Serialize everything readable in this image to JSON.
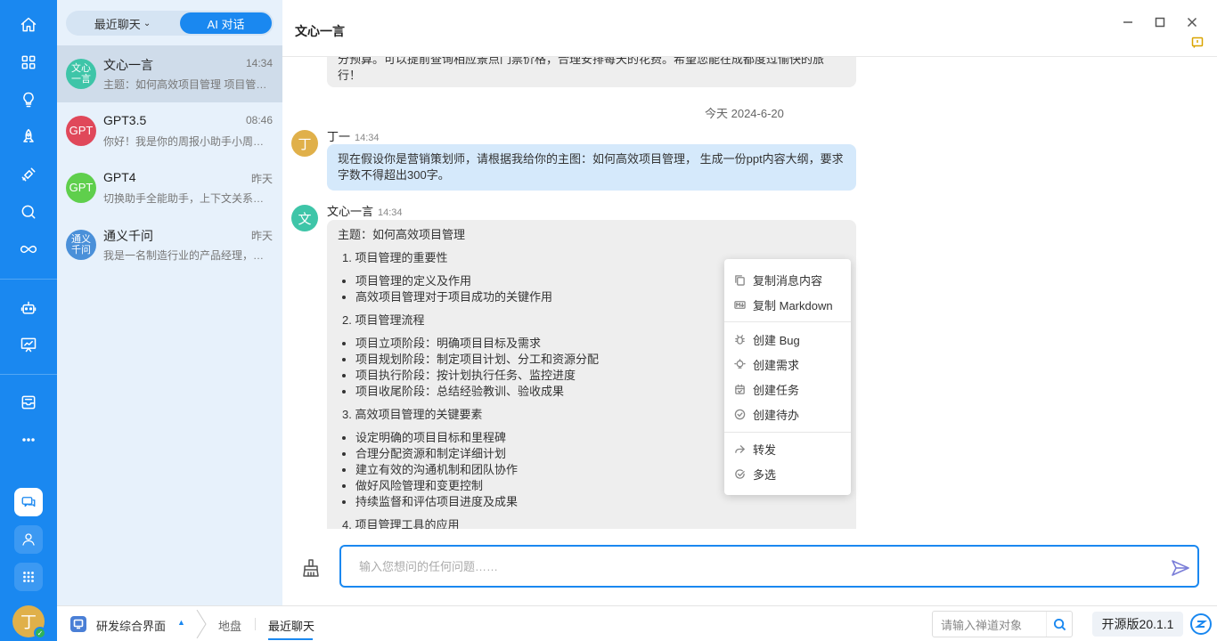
{
  "colors": {
    "accent": "#1a88f0",
    "rail": "#1a88f0",
    "list_bg": "#e7f1fb",
    "user_bubble": "#d5e9fb",
    "bot_bubble": "#eeeeee"
  },
  "rail": {
    "icons": [
      "home-icon",
      "apps-grid-icon",
      "bulb-icon",
      "rocket-icon",
      "satellite-icon",
      "search-icon",
      "infinity-icon",
      "robot-icon",
      "chart-board-icon",
      "inbox-icon",
      "more-icon"
    ],
    "bottom": [
      "chat-bubbles-icon",
      "contacts-icon",
      "app-launcher-icon"
    ],
    "user_avatar": "丁"
  },
  "chat_list": {
    "tabs": {
      "recent": "最近聊天",
      "ai": "AI 对话"
    },
    "conversations": [
      {
        "name": "文心一言",
        "time": "14:34",
        "preview": "主题：如何高效项目管理 项目管理的重要性",
        "avatar": "文心\n一言",
        "color": "#3ec5a8"
      },
      {
        "name": "GPT3.5",
        "time": "08:46",
        "preview": "你好！我是你的周报小助手小周，请告诉我",
        "avatar": "GPT",
        "color": "#e0485a"
      },
      {
        "name": "GPT4",
        "time": "昨天",
        "preview": "切换助手全能助手，上下文关系已清空",
        "avatar": "GPT",
        "color": "#5fcf4c"
      },
      {
        "name": "通义千问",
        "time": "昨天",
        "preview": "我是一名制造行业的产品经理，请帮我",
        "avatar": "通义\n千问",
        "color": "#4a90d9"
      }
    ]
  },
  "header": {
    "title": "文心一言"
  },
  "messages": {
    "prev_bubble": "分预算。可以提前查询相应景点门票价格，合理安排每天的花费。希望您能在成都度过愉快的旅\n行！",
    "date_divider": "今天 2024-6-20",
    "user": {
      "name": "丁一",
      "time": "14:34",
      "avatar": "丁",
      "text": "现在假设你是营销策划师，请根据我给你的主图：如何高效项目管理， 生成一份ppt内容大纲，要求字数不得超出300字。"
    },
    "bot": {
      "name": "文心一言",
      "time": "14:34",
      "avatar": "文",
      "heading": "主题：如何高效项目管理",
      "sections": [
        {
          "title": "1. 项目管理的重要性",
          "items": [
            "项目管理的定义及作用",
            "高效项目管理对于项目成功的关键作用"
          ]
        },
        {
          "title": "2. 项目管理流程",
          "items": [
            "项目立项阶段：明确项目目标及需求",
            "项目规划阶段：制定项目计划、分工和资源分配",
            "项目执行阶段：按计划执行任务、监控进度",
            "项目收尾阶段：总结经验教训、验收成果"
          ]
        },
        {
          "title": "3. 高效项目管理的关键要素",
          "items": [
            "设定明确的项目目标和里程碑",
            "合理分配资源和制定详细计划",
            "建立有效的沟通机制和团队协作",
            "做好风险管理和变更控制",
            "持续监督和评估项目进度及成果"
          ]
        },
        {
          "title": "4. 项目管理工具的应用",
          "items": []
        }
      ]
    }
  },
  "context_menu": {
    "copy_content": "复制消息内容",
    "copy_markdown": "复制 Markdown",
    "create_bug": "创建 Bug",
    "create_story": "创建需求",
    "create_task": "创建任务",
    "create_todo": "创建待办",
    "forward": "转发",
    "multi_select": "多选"
  },
  "input": {
    "placeholder": "输入您想问的任何问题……"
  },
  "bottom_bar": {
    "workspace": "研发综合界面",
    "crumbs": [
      "地盘",
      "最近聊天"
    ],
    "search_placeholder": "请输入禅道对象",
    "version": "开源版20.1.1"
  }
}
